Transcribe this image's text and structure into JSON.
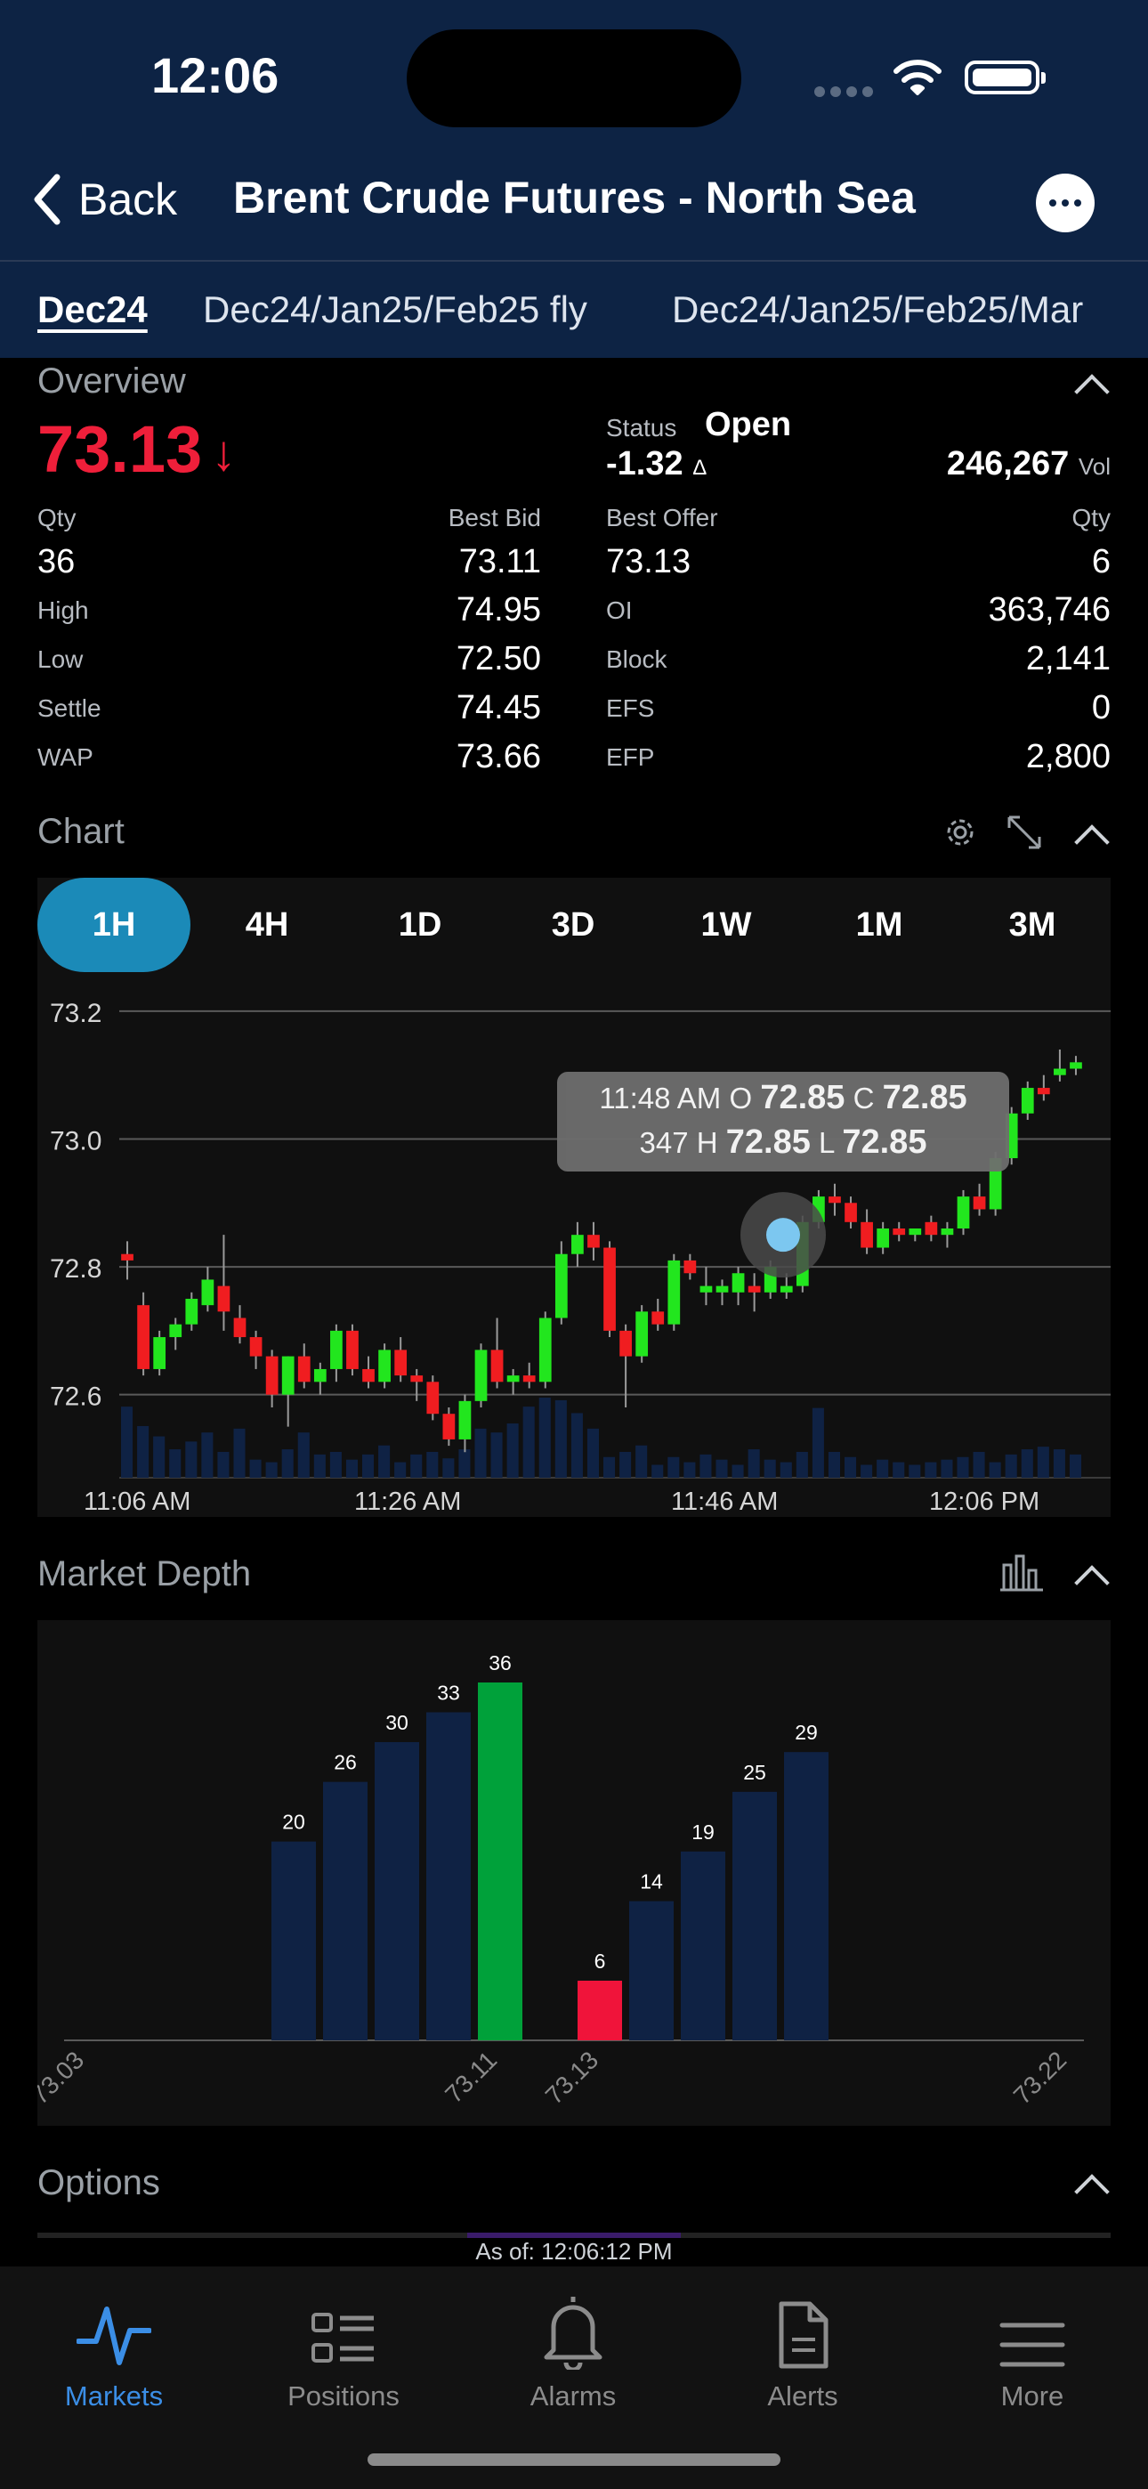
{
  "status_bar": {
    "time": "12:06"
  },
  "header": {
    "back_label": "Back",
    "title": "Brent Crude Futures - North Sea"
  },
  "contract_tabs": [
    "Dec24",
    "Dec24/Jan25/Feb25 fly",
    "Dec24/Jan25/Feb25/Mar"
  ],
  "overview": {
    "section_title": "Overview",
    "last_price": "73.13",
    "direction_arrow": "↓",
    "status_label": "Status",
    "status_value": "Open",
    "change": "-1.32",
    "change_symbol": "Δ",
    "volume": "246,267",
    "volume_unit": "Vol",
    "rows": [
      {
        "l1": "Qty",
        "v1": "",
        "l2": "Best Bid",
        "v2": "",
        "l3": "Best Offer",
        "v3": "",
        "l4": "Qty",
        "v4": ""
      },
      {
        "l1": "",
        "v1": "36",
        "l2": "",
        "v2": "73.11",
        "l3": "",
        "v3": "73.13",
        "l4": "",
        "v4": "6"
      },
      {
        "l1": "High",
        "v2": "74.95",
        "l3": "OI",
        "v4": "363,746"
      },
      {
        "l1": "Low",
        "v2": "72.50",
        "l3": "Block",
        "v4": "2,141"
      },
      {
        "l1": "Settle",
        "v2": "74.45",
        "l3": "EFS",
        "v4": "0"
      },
      {
        "l1": "WAP",
        "v2": "73.66",
        "l3": "EFP",
        "v4": "2,800"
      }
    ]
  },
  "chart_section": {
    "title": "Chart",
    "ranges": [
      "1H",
      "4H",
      "1D",
      "3D",
      "1W",
      "1M",
      "3M"
    ],
    "active_range": "1H",
    "tooltip": {
      "time": "11:48 AM",
      "o_label": "O",
      "o": "72.85",
      "c_label": "C",
      "c": "72.85",
      "volume": "347",
      "h_label": "H",
      "h": "72.85",
      "l_label": "L",
      "l": "72.85"
    }
  },
  "chart_data": [
    {
      "type": "candlestick",
      "title": "",
      "y_ticks": [
        "73.2",
        "73.0",
        "72.8",
        "72.6"
      ],
      "ylim": [
        72.47,
        73.25
      ],
      "x_ticks": [
        "11:06 AM",
        "11:26 AM",
        "11:46 AM",
        "12:06 PM"
      ],
      "colors": {
        "up": "#22e61e",
        "down": "#f01d20",
        "volume": "#0f2244"
      },
      "candles": [
        {
          "o": 72.82,
          "h": 72.84,
          "l": 72.78,
          "c": 72.81
        },
        {
          "o": 72.74,
          "h": 72.76,
          "l": 72.63,
          "c": 72.64
        },
        {
          "o": 72.64,
          "h": 72.7,
          "l": 72.63,
          "c": 72.69
        },
        {
          "o": 72.69,
          "h": 72.72,
          "l": 72.67,
          "c": 72.71
        },
        {
          "o": 72.71,
          "h": 72.76,
          "l": 72.7,
          "c": 72.75
        },
        {
          "o": 72.74,
          "h": 72.8,
          "l": 72.73,
          "c": 72.78
        },
        {
          "o": 72.77,
          "h": 72.85,
          "l": 72.7,
          "c": 72.73
        },
        {
          "o": 72.72,
          "h": 72.74,
          "l": 72.68,
          "c": 72.69
        },
        {
          "o": 72.69,
          "h": 72.7,
          "l": 72.64,
          "c": 72.66
        },
        {
          "o": 72.66,
          "h": 72.67,
          "l": 72.58,
          "c": 72.6
        },
        {
          "o": 72.6,
          "h": 72.66,
          "l": 72.55,
          "c": 72.66
        },
        {
          "o": 72.66,
          "h": 72.68,
          "l": 72.61,
          "c": 72.62
        },
        {
          "o": 72.62,
          "h": 72.65,
          "l": 72.6,
          "c": 72.64
        },
        {
          "o": 72.64,
          "h": 72.71,
          "l": 72.62,
          "c": 72.7
        },
        {
          "o": 72.7,
          "h": 72.71,
          "l": 72.63,
          "c": 72.64
        },
        {
          "o": 72.64,
          "h": 72.66,
          "l": 72.61,
          "c": 72.62
        },
        {
          "o": 72.62,
          "h": 72.68,
          "l": 72.61,
          "c": 72.67
        },
        {
          "o": 72.67,
          "h": 72.69,
          "l": 72.62,
          "c": 72.63
        },
        {
          "o": 72.63,
          "h": 72.64,
          "l": 72.59,
          "c": 72.62
        },
        {
          "o": 72.62,
          "h": 72.63,
          "l": 72.56,
          "c": 72.57
        },
        {
          "o": 72.57,
          "h": 72.58,
          "l": 72.52,
          "c": 72.53
        },
        {
          "o": 72.53,
          "h": 72.6,
          "l": 72.51,
          "c": 72.59
        },
        {
          "o": 72.59,
          "h": 72.68,
          "l": 72.58,
          "c": 72.67
        },
        {
          "o": 72.67,
          "h": 72.72,
          "l": 72.61,
          "c": 72.62
        },
        {
          "o": 72.62,
          "h": 72.64,
          "l": 72.6,
          "c": 72.63
        },
        {
          "o": 72.63,
          "h": 72.65,
          "l": 72.61,
          "c": 72.62
        },
        {
          "o": 72.62,
          "h": 72.73,
          "l": 72.61,
          "c": 72.72
        },
        {
          "o": 72.72,
          "h": 72.84,
          "l": 72.71,
          "c": 72.82
        },
        {
          "o": 72.82,
          "h": 72.87,
          "l": 72.8,
          "c": 72.85
        },
        {
          "o": 72.85,
          "h": 72.87,
          "l": 72.81,
          "c": 72.83
        },
        {
          "o": 72.83,
          "h": 72.84,
          "l": 72.69,
          "c": 72.7
        },
        {
          "o": 72.7,
          "h": 72.71,
          "l": 72.58,
          "c": 72.66
        },
        {
          "o": 72.66,
          "h": 72.74,
          "l": 72.65,
          "c": 72.73
        },
        {
          "o": 72.73,
          "h": 72.75,
          "l": 72.7,
          "c": 72.71
        },
        {
          "o": 72.71,
          "h": 72.82,
          "l": 72.7,
          "c": 72.81
        },
        {
          "o": 72.81,
          "h": 72.82,
          "l": 72.78,
          "c": 72.79
        },
        {
          "o": 72.76,
          "h": 72.8,
          "l": 72.74,
          "c": 72.77
        },
        {
          "o": 72.76,
          "h": 72.78,
          "l": 72.74,
          "c": 72.77
        },
        {
          "o": 72.76,
          "h": 72.8,
          "l": 72.74,
          "c": 72.79
        },
        {
          "o": 72.77,
          "h": 72.79,
          "l": 72.73,
          "c": 72.76
        },
        {
          "o": 72.76,
          "h": 72.81,
          "l": 72.75,
          "c": 72.8
        },
        {
          "o": 72.76,
          "h": 72.79,
          "l": 72.75,
          "c": 72.77
        },
        {
          "o": 72.77,
          "h": 72.88,
          "l": 72.76,
          "c": 72.87
        },
        {
          "o": 72.87,
          "h": 72.92,
          "l": 72.86,
          "c": 72.91
        },
        {
          "o": 72.91,
          "h": 72.93,
          "l": 72.88,
          "c": 72.9
        },
        {
          "o": 72.9,
          "h": 72.91,
          "l": 72.86,
          "c": 72.87
        },
        {
          "o": 72.87,
          "h": 72.89,
          "l": 72.82,
          "c": 72.83
        },
        {
          "o": 72.83,
          "h": 72.87,
          "l": 72.82,
          "c": 72.86
        },
        {
          "o": 72.86,
          "h": 72.87,
          "l": 72.84,
          "c": 72.85
        },
        {
          "o": 72.85,
          "h": 72.86,
          "l": 72.84,
          "c": 72.86
        },
        {
          "o": 72.87,
          "h": 72.88,
          "l": 72.84,
          "c": 72.85
        },
        {
          "o": 72.85,
          "h": 72.87,
          "l": 72.83,
          "c": 72.86
        },
        {
          "o": 72.86,
          "h": 72.92,
          "l": 72.85,
          "c": 72.91
        },
        {
          "o": 72.91,
          "h": 72.93,
          "l": 72.88,
          "c": 72.89
        },
        {
          "o": 72.89,
          "h": 72.98,
          "l": 72.88,
          "c": 72.97
        },
        {
          "o": 72.97,
          "h": 73.05,
          "l": 72.96,
          "c": 73.04
        },
        {
          "o": 73.04,
          "h": 73.09,
          "l": 73.03,
          "c": 73.08
        },
        {
          "o": 73.08,
          "h": 73.1,
          "l": 73.06,
          "c": 73.07
        },
        {
          "o": 73.1,
          "h": 73.14,
          "l": 73.09,
          "c": 73.11
        },
        {
          "o": 73.11,
          "h": 73.13,
          "l": 73.1,
          "c": 73.12
        }
      ],
      "volume": [
        55,
        40,
        32,
        22,
        28,
        35,
        20,
        38,
        14,
        12,
        22,
        35,
        18,
        20,
        14,
        18,
        25,
        12,
        18,
        20,
        15,
        22,
        38,
        35,
        42,
        55,
        62,
        60,
        50,
        38,
        16,
        20,
        25,
        10,
        16,
        12,
        18,
        14,
        10,
        22,
        14,
        12,
        20,
        54,
        20,
        16,
        10,
        14,
        12,
        10,
        12,
        14,
        16,
        20,
        12,
        18,
        22,
        24,
        22,
        18
      ],
      "hover": {
        "time": "11:48 AM",
        "price": 72.85
      }
    },
    {
      "type": "bar",
      "title": "",
      "xlabel": "",
      "ylabel": "",
      "x_tick_labels": [
        "73.03",
        "73.11",
        "73.13",
        "73.22"
      ],
      "bids": {
        "values": [
          20,
          26,
          30,
          33,
          36
        ],
        "best_color": "#00a13a"
      },
      "offers": {
        "values": [
          6,
          14,
          19,
          25,
          29
        ],
        "best_color": "#f0143a"
      },
      "bar_color": "#0f2244",
      "ylim": [
        0,
        36
      ]
    }
  ],
  "depth_section": {
    "title": "Market Depth"
  },
  "options_section": {
    "title": "Options"
  },
  "as_of": "As of: 12:06:12 PM",
  "tab_bar": [
    "Markets",
    "Positions",
    "Alarms",
    "Alerts",
    "More"
  ]
}
